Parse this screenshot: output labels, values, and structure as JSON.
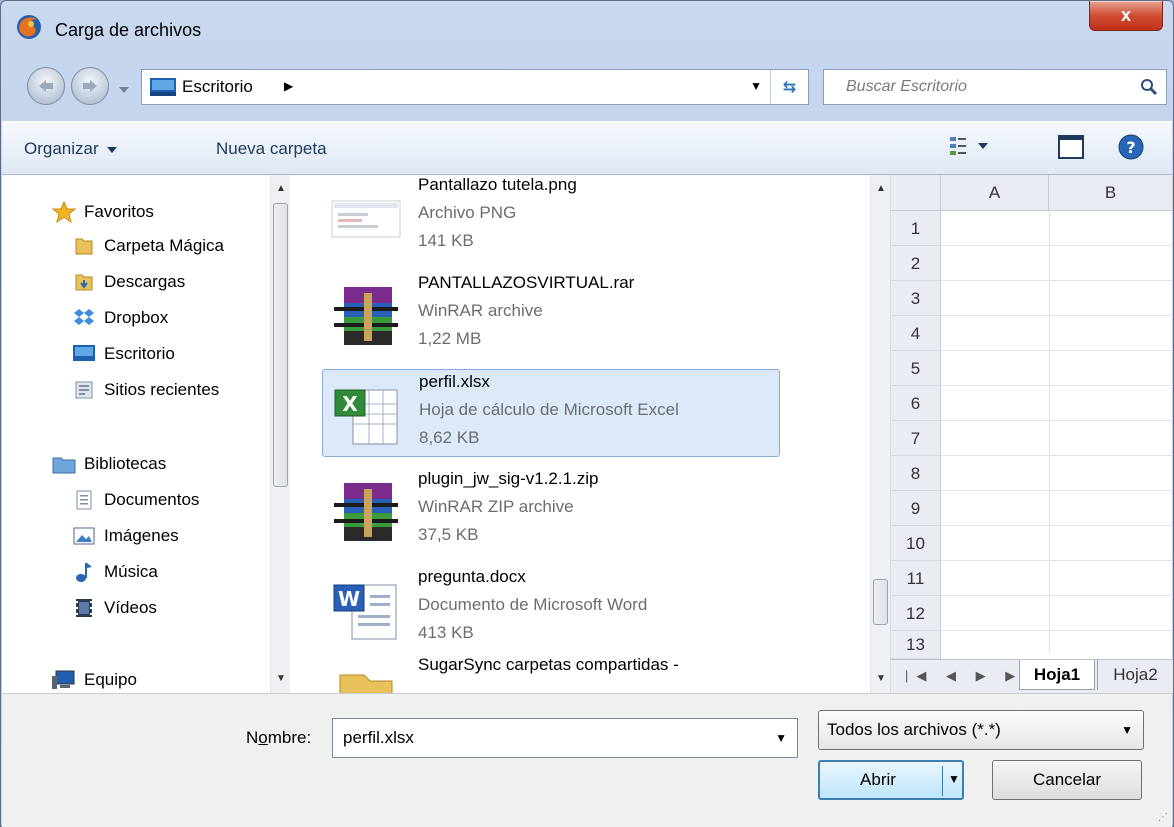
{
  "window": {
    "title": "Carga de archivos",
    "close_label": "x"
  },
  "address": {
    "location": "Escritorio"
  },
  "search": {
    "placeholder": "Buscar Escritorio"
  },
  "toolbar": {
    "organize": "Organizar",
    "new_folder": "Nueva carpeta"
  },
  "nav": {
    "favorites_header": "Favoritos",
    "favorites": [
      "Carpeta Mágica",
      "Descargas",
      "Dropbox",
      "Escritorio",
      "Sitios recientes"
    ],
    "libraries_header": "Bibliotecas",
    "libraries": [
      "Documentos",
      "Imágenes",
      "Música",
      "Vídeos"
    ],
    "computer": "Equipo"
  },
  "files": [
    {
      "name": "Pantallazo tutela.png",
      "type": "Archivo PNG",
      "size": "141 KB",
      "icon": "image-thumbnail-icon"
    },
    {
      "name": "PANTALLAZOSVIRTUAL.rar",
      "type": "WinRAR archive",
      "size": "1,22 MB",
      "icon": "winrar-icon"
    },
    {
      "name": "perfil.xlsx",
      "type": "Hoja de cálculo de Microsoft Excel",
      "size": "8,62 KB",
      "icon": "excel-icon"
    },
    {
      "name": "plugin_jw_sig-v1.2.1.zip",
      "type": "WinRAR ZIP archive",
      "size": "37,5 KB",
      "icon": "winrar-icon"
    },
    {
      "name": "pregunta.docx",
      "type": "Documento de Microsoft Word",
      "size": "413 KB",
      "icon": "word-icon"
    },
    {
      "name": "SugarSync carpetas compartidas -",
      "type": "",
      "size": "",
      "icon": "folder-icon"
    }
  ],
  "preview": {
    "columns": [
      "A",
      "B"
    ],
    "rows": [
      "1",
      "2",
      "3",
      "4",
      "5",
      "6",
      "7",
      "8",
      "9",
      "10",
      "11",
      "12",
      "13"
    ],
    "sheets": [
      "Hoja1",
      "Hoja2"
    ]
  },
  "footer": {
    "name_label_prefix": "N",
    "name_label_underlined": "o",
    "name_label_suffix": "mbre:",
    "name_value": "perfil.xlsx",
    "type_value": "Todos los archivos (*.*)",
    "open_label": "Abrir",
    "cancel_label": "Cancelar"
  },
  "colors": {
    "selection": "#dce9f8",
    "selection_border": "#84acdd",
    "accent": "#3c7fb1"
  }
}
